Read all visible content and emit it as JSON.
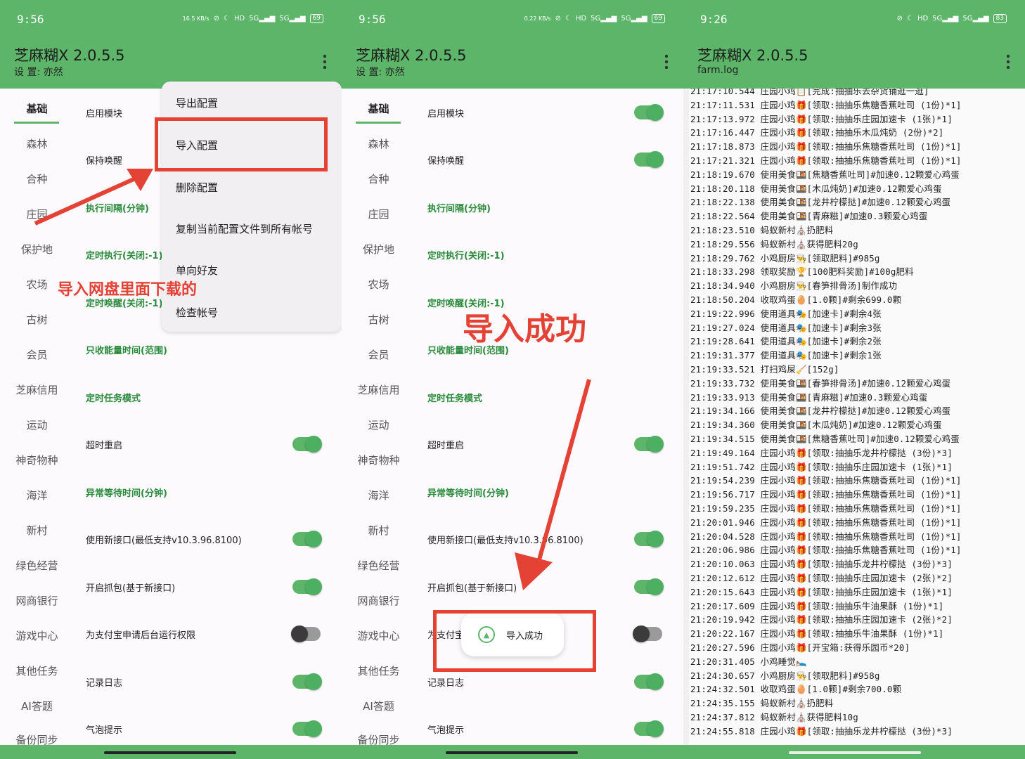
{
  "app": {
    "title": "芝麻糊X 2.0.5.5"
  },
  "panels": [
    {
      "time": "9:56",
      "net_speed": "16.5 KB/s",
      "battery": "69",
      "subtitle": "设 置: 亦然"
    },
    {
      "time": "9:56",
      "net_speed": "0.22 KB/s",
      "battery": "69",
      "subtitle": "设 置: 亦然"
    },
    {
      "time": "9:26",
      "battery": "83",
      "subtitle": "farm.log"
    }
  ],
  "sidebar": [
    "基础",
    "森林",
    "合种",
    "庄园",
    "保护地",
    "农场",
    "古树",
    "会员",
    "芝麻信用",
    "运动",
    "神奇物种",
    "海洋",
    "新村",
    "绿色经营",
    "网商银行",
    "游戏中心",
    "其他任务",
    "AI答题",
    "备份同步"
  ],
  "settings": [
    {
      "label": "启用模块",
      "type": "toggle",
      "on": true
    },
    {
      "label": "保持唤醒",
      "type": "toggle",
      "on": true
    },
    {
      "label": "执行间隔(分钟)",
      "type": "header"
    },
    {
      "label": "定时执行(关闭:-1)",
      "type": "header"
    },
    {
      "label": "定时唤醒(关闭:-1)",
      "type": "header"
    },
    {
      "label": "只收能量时间(范围)",
      "type": "header"
    },
    {
      "label": "定时任务模式",
      "type": "header"
    },
    {
      "label": "超时重启",
      "type": "toggle",
      "on": true
    },
    {
      "label": "异常等待时间(分钟)",
      "type": "header"
    },
    {
      "label": "使用新接口(最低支持v10.3.96.8100)",
      "type": "toggle",
      "on": true
    },
    {
      "label": "开启抓包(基于新接口)",
      "type": "toggle",
      "on": true
    },
    {
      "label": "为支付宝申请后台运行权限",
      "type": "toggle",
      "on": false
    },
    {
      "label": "记录日志",
      "type": "toggle",
      "on": true
    },
    {
      "label": "气泡提示",
      "type": "toggle",
      "on": true
    }
  ],
  "menu": [
    "导出配置",
    "导入配置",
    "删除配置",
    "复制当前配置文件到所有帐号",
    "单向好友",
    "检查帐号"
  ],
  "annotations": {
    "download_note": "导入网盘里面下载的",
    "success_note": "导入成功"
  },
  "toast": {
    "text": "导入成功"
  },
  "log": [
    "21:17:10.544 庄园小鸡📋[完成:抽抽乐去杂货铺逛一逛]",
    "21:17:11.531 庄园小鸡🎁[领取:抽抽乐焦糖香蕉吐司 (1份)*1]",
    "21:17:13.972 庄园小鸡🎁[领取:抽抽乐庄园加速卡 (1张)*1]",
    "21:17:16.447 庄园小鸡🎁[领取:抽抽乐木瓜炖奶 (2份)*2]",
    "21:17:18.873 庄园小鸡🎁[领取:抽抽乐焦糖香蕉吐司 (1份)*1]",
    "21:17:21.321 庄园小鸡🎁[领取:抽抽乐焦糖香蕉吐司 (1份)*1]",
    "21:18:19.670 使用美食🍱[焦糖香蕉吐司]#加速0.12颗爱心鸡蛋",
    "21:18:20.118 使用美食🍱[木瓜炖奶]#加速0.12颗爱心鸡蛋",
    "21:18:22.138 使用美食🍱[龙井柠檬挞]#加速0.12颗爱心鸡蛋",
    "21:18:22.564 使用美食🍱[青麻糍]#加速0.3颗爱心鸡蛋",
    "21:18:23.510 蚂蚁新村⛪扔肥料",
    "21:18:29.556 蚂蚁新村⛪获得肥料20g",
    "21:18:29.762 小鸡厨房👨‍🍳[领取肥料]#985g",
    "21:18:33.298 领取奖励🏆[100肥料奖励]#100g肥料",
    "21:18:34.940 小鸡厨房👨‍🍳[春笋排骨汤]制作成功",
    "21:18:50.204 收取鸡蛋🥚[1.0颗]#剩余699.0颗",
    "21:19:22.996 使用道具🎭[加速卡]#剩余4张",
    "21:19:27.024 使用道具🎭[加速卡]#剩余3张",
    "21:19:28.641 使用道具🎭[加速卡]#剩余2张",
    "21:19:31.377 使用道具🎭[加速卡]#剩余1张",
    "21:19:33.521 打扫鸡屎🧹[152g]",
    "21:19:33.732 使用美食🍱[春笋排骨汤]#加速0.12颗爱心鸡蛋",
    "21:19:33.913 使用美食🍱[青麻糍]#加速0.3颗爱心鸡蛋",
    "21:19:34.166 使用美食🍱[龙井柠檬挞]#加速0.12颗爱心鸡蛋",
    "21:19:34.360 使用美食🍱[木瓜炖奶]#加速0.12颗爱心鸡蛋",
    "21:19:34.515 使用美食🍱[焦糖香蕉吐司]#加速0.12颗爱心鸡蛋",
    "21:19:49.164 庄园小鸡🎁[领取:抽抽乐龙井柠檬挞 (3份)*3]",
    "21:19:51.742 庄园小鸡🎁[领取:抽抽乐庄园加速卡 (1张)*1]",
    "21:19:54.239 庄园小鸡🎁[领取:抽抽乐焦糖香蕉吐司 (1份)*1]",
    "21:19:56.717 庄园小鸡🎁[领取:抽抽乐焦糖香蕉吐司 (1份)*1]",
    "21:19:59.235 庄园小鸡🎁[领取:抽抽乐焦糖香蕉吐司 (1份)*1]",
    "21:20:01.946 庄园小鸡🎁[领取:抽抽乐焦糖香蕉吐司 (1份)*1]",
    "21:20:04.528 庄园小鸡🎁[领取:抽抽乐焦糖香蕉吐司 (1份)*1]",
    "21:20:06.986 庄园小鸡🎁[领取:抽抽乐焦糖香蕉吐司 (1份)*1]",
    "21:20:10.063 庄园小鸡🎁[领取:抽抽乐龙井柠檬挞 (3份)*3]",
    "21:20:12.612 庄园小鸡🎁[领取:抽抽乐庄园加速卡 (2张)*2]",
    "21:20:15.643 庄园小鸡🎁[领取:抽抽乐庄园加速卡 (1张)*1]",
    "21:20:17.609 庄园小鸡🎁[领取:抽抽乐牛油果酥 (1份)*1]",
    "21:20:19.942 庄园小鸡🎁[领取:抽抽乐庄园加速卡 (2张)*2]",
    "21:20:22.167 庄园小鸡🎁[领取:抽抽乐牛油果酥 (1份)*1]",
    "21:20:27.596 庄园小鸡🎁[开宝箱:获得乐园币*20]",
    "21:20:31.405 小鸡睡觉🛌",
    "21:24:30.657 小鸡厨房👨‍🍳[领取肥料]#958g",
    "21:24:32.501 收取鸡蛋🥚[1.0颗]#剩余700.0颗",
    "21:24:35.155 蚂蚁新村⛪扔肥料",
    "21:24:37.812 蚂蚁新村⛪获得肥料10g",
    "21:24:55.818 庄园小鸡🎁[领取:抽抽乐龙井柠檬挞 (3份)*3]"
  ],
  "colors": {
    "accent": "#5db56a",
    "annotation": "#e34234"
  }
}
